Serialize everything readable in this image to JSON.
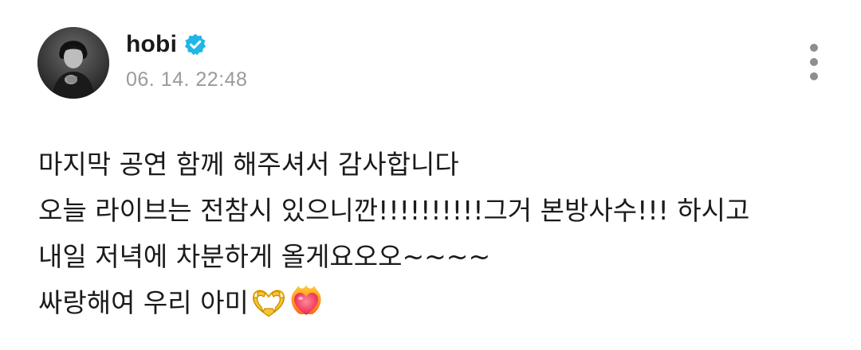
{
  "post": {
    "author": {
      "name": "hobi",
      "verified": true,
      "badge_color": "#1fb6e8"
    },
    "timestamp": "06. 14. 22:48",
    "more_menu_icon": "more-vertical-icon",
    "body_lines": [
      "마지막 공연 함께 해주셔서 감사합니다",
      "오늘 라이브는 전참시 있으니깐!!!!!!!!!!그거 본방사수!!! 하시고",
      "내일 저녁에 차분하게 올게요오오~~~~",
      "싸랑해여 우리 아미"
    ],
    "trailing_emojis": [
      "heart-hands-emoji",
      "heart-on-fire-emoji"
    ]
  }
}
